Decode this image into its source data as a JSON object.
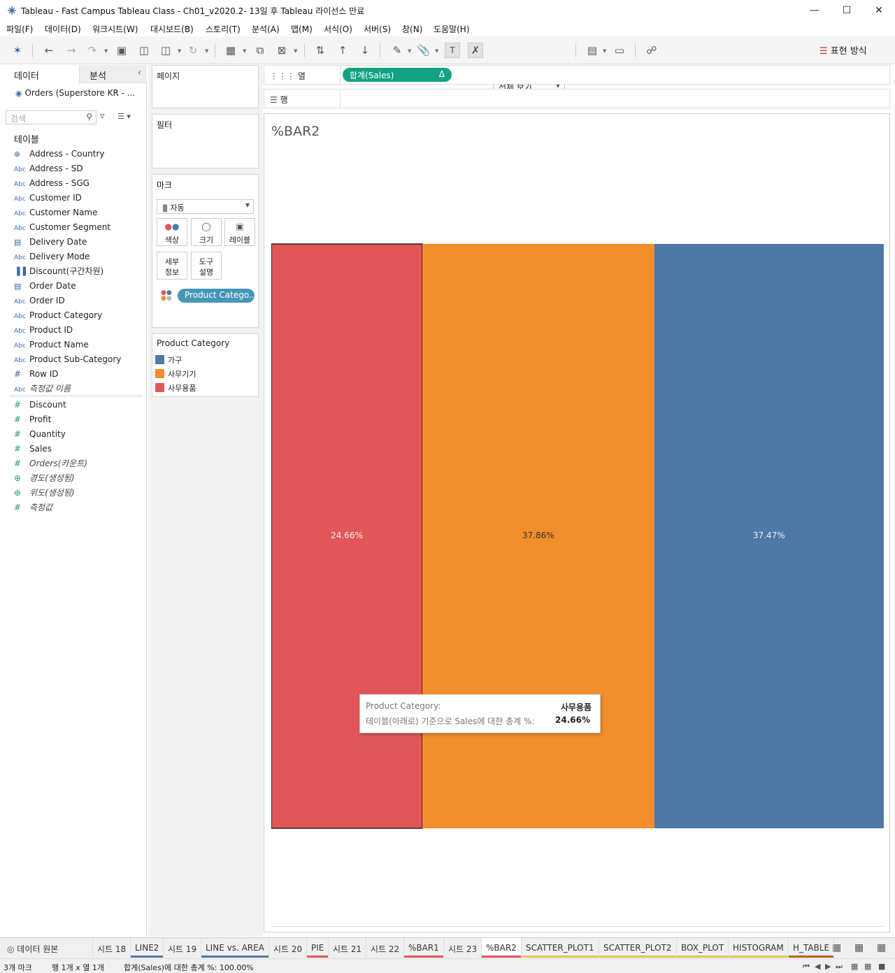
{
  "window": {
    "title": "Tableau - Fast Campus Tableau Class - Ch01_v2020.2- 13일 후 Tableau 라이선스 만료"
  },
  "menu": [
    "파일(F)",
    "데이터(D)",
    "워크시트(W)",
    "대시보드(B)",
    "스토리(T)",
    "분석(A)",
    "맵(M)",
    "서식(O)",
    "서버(S)",
    "창(N)",
    "도움말(H)"
  ],
  "toolbar": {
    "view_mode": "전체 보기",
    "show_me": "표현 방식"
  },
  "left_pane": {
    "tab_data": "데이터",
    "tab_analysis": "분석",
    "datasource": "Orders (Superstore KR - ...",
    "search_placeholder": "검색",
    "tables_header": "테이블",
    "dimensions": [
      {
        "icon": "globe",
        "label": "Address - Country"
      },
      {
        "icon": "Abc",
        "label": "Address - SD"
      },
      {
        "icon": "Abc",
        "label": "Address - SGG"
      },
      {
        "icon": "Abc",
        "label": "Customer ID"
      },
      {
        "icon": "Abc",
        "label": "Customer Name"
      },
      {
        "icon": "Abc",
        "label": "Customer Segment"
      },
      {
        "icon": "calendar",
        "label": "Delivery Date"
      },
      {
        "icon": "Abc",
        "label": "Delivery Mode"
      },
      {
        "icon": "bin",
        "label": "Discount(구간차원)"
      },
      {
        "icon": "calendar",
        "label": "Order Date"
      },
      {
        "icon": "Abc",
        "label": "Order ID"
      },
      {
        "icon": "Abc",
        "label": "Product Category"
      },
      {
        "icon": "Abc",
        "label": "Product ID"
      },
      {
        "icon": "Abc",
        "label": "Product Name"
      },
      {
        "icon": "Abc",
        "label": "Product Sub-Category"
      },
      {
        "icon": "#",
        "label": "Row ID"
      },
      {
        "icon": "Abc",
        "label": "측정값 이름",
        "italic": true
      }
    ],
    "measures": [
      {
        "icon": "#",
        "label": "Discount"
      },
      {
        "icon": "#",
        "label": "Profit"
      },
      {
        "icon": "#",
        "label": "Quantity"
      },
      {
        "icon": "#",
        "label": "Sales"
      },
      {
        "icon": "#",
        "label": "Orders(카운트)",
        "italic": true
      },
      {
        "icon": "globe",
        "label": "경도(생성됨)",
        "italic": true
      },
      {
        "icon": "globe",
        "label": "위도(생성됨)",
        "italic": true
      },
      {
        "icon": "#",
        "label": "측정값",
        "italic": true
      }
    ]
  },
  "cards": {
    "pages": "페이지",
    "filters": "필터",
    "marks": "마크",
    "mark_type": "자동",
    "mark_buttons": [
      "색상",
      "크기",
      "레이블",
      "세부\n정보",
      "도구\n설명"
    ],
    "color_pill": "Product Catego..",
    "legend_title": "Product Category",
    "legend": [
      {
        "label": "가구",
        "color": "#4e79a7"
      },
      {
        "label": "사무기기",
        "color": "#f28e2b"
      },
      {
        "label": "사무용품",
        "color": "#e15759"
      }
    ]
  },
  "shelves": {
    "columns_label": "열",
    "rows_label": "행",
    "column_pill": "합계(Sales)",
    "column_pill_badge": "Δ"
  },
  "sheet": {
    "title": "%BAR2"
  },
  "chart_data": {
    "type": "bar",
    "stacked": true,
    "orientation": "horizontal",
    "xlim": [
      0,
      100
    ],
    "series": [
      {
        "name": "사무용품",
        "value": 24.66,
        "label": "24.66%",
        "color": "#e15759",
        "label_color": "#fdf0f0",
        "selected": true
      },
      {
        "name": "사무기기",
        "value": 37.86,
        "label": "37.86%",
        "color": "#f28e2b",
        "label_color": "#333333"
      },
      {
        "name": "가구",
        "value": 37.47,
        "label": "37.47%",
        "color": "#4e79a7",
        "label_color": "#eaf0f7"
      }
    ]
  },
  "tooltip": {
    "k1": "Product Category:",
    "v1": "사무용품",
    "k2": "테이블(아래로) 기준으로 Sales에 대한 총계 %:",
    "v2": "24.66%"
  },
  "sheet_tabs": [
    {
      "label": "데이터 원본",
      "icon": "db"
    },
    {
      "label": "시트 18"
    },
    {
      "label": "LINE2",
      "color": "#4e79a7"
    },
    {
      "label": "시트 19"
    },
    {
      "label": "LINE vs. AREA",
      "color": "#4e79a7"
    },
    {
      "label": "시트 20"
    },
    {
      "label": "PIE",
      "color": "#e15759"
    },
    {
      "label": "시트 21"
    },
    {
      "label": "시트 22"
    },
    {
      "label": "%BAR1",
      "color": "#e15759"
    },
    {
      "label": "시트 23"
    },
    {
      "label": "%BAR2",
      "color": "#e15759",
      "active": true
    },
    {
      "label": "SCATTER_PLOT1",
      "color": "#e6c35c"
    },
    {
      "label": "SCATTER_PLOT2",
      "color": "#e6c35c"
    },
    {
      "label": "BOX_PLOT",
      "color": "#e6c35c"
    },
    {
      "label": "HISTOGRAM",
      "color": "#e6c35c"
    },
    {
      "label": "H_TABLE",
      "color": "#b5651d"
    }
  ],
  "status": {
    "marks": "3개 마크",
    "rows_cols": "행 1개 x 열 1개",
    "summary": "합계(Sales)에 대한 총계 %: 100.00%"
  }
}
